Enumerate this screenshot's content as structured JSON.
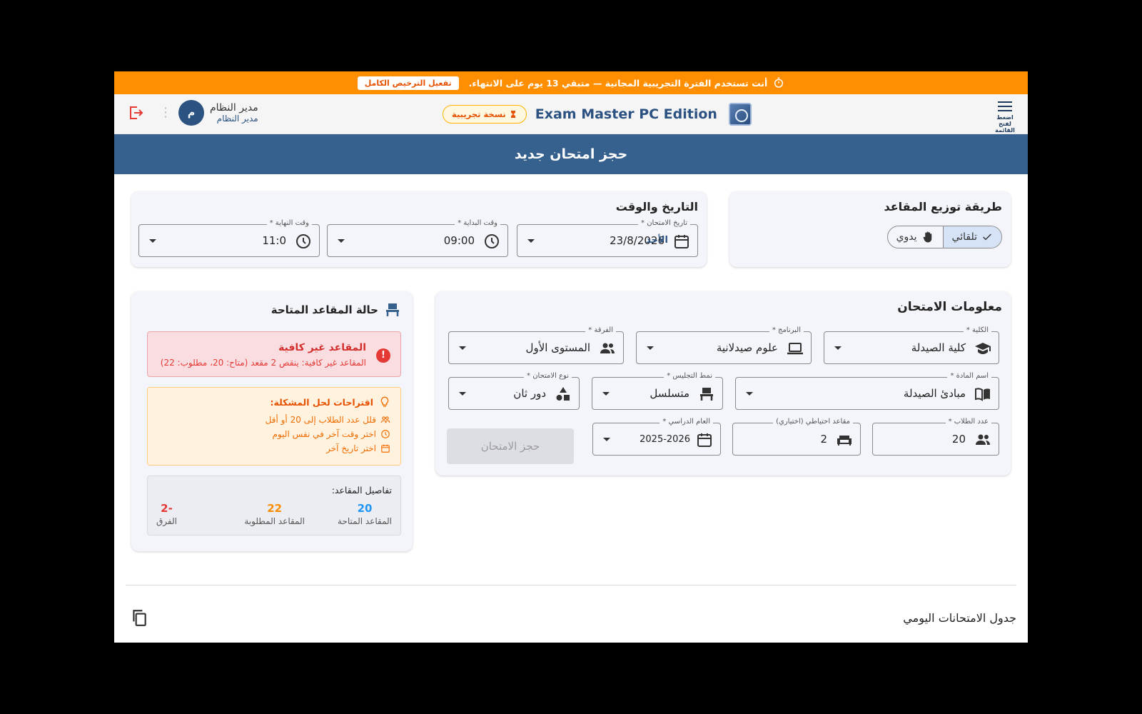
{
  "trial_banner": {
    "message": "أنت تستخدم الفترة التجريبية المجانية — متبقي 13 يوم على الانتهاء.",
    "activate_button": "تفعيل الترخيص الكامل"
  },
  "appbar": {
    "menu_hint": "اضغط لفتح القائمة",
    "app_title": "Exam Master PC Edition",
    "trial_badge": "نسخة تجريبية",
    "user_name": "مدير النظام",
    "user_role": "مدير النظام",
    "avatar_letter": "م"
  },
  "page_title": "حجز امتحان جديد",
  "seat_method": {
    "title": "طريقة توزيع المقاعد",
    "options": [
      "تلقائي",
      "يدوي"
    ],
    "selected": "تلقائي"
  },
  "datetime": {
    "title": "التاريخ والوقت",
    "exam_date_label": "تاريخ الامتحان *",
    "exam_date": "23/8/2026",
    "day_name": "الأحد",
    "start_label": "وقت البداية *",
    "start_time": "09:00",
    "end_label": "وقت النهاية *",
    "end_time": "11:0"
  },
  "exam_info": {
    "title": "معلومات الامتحان",
    "college_label": "الكلية *",
    "college": "كلية الصيدلة",
    "program_label": "البرنامج *",
    "program": "علوم صيدلانية",
    "group_label": "الفرقة *",
    "group": "المستوى الأول",
    "subject_label": "اسم المادة *",
    "subject": "مبادئ الصيدلة",
    "seating_label": "نمط التجليس *",
    "seating": "متسلسل",
    "exam_type_label": "نوع الامتحان *",
    "exam_type": "دور ثان",
    "students_label": "عدد الطلاب *",
    "students": "20",
    "reserve_label": "مقاعد احتياطي (اختياري)",
    "reserve": "2",
    "year_label": "العام الدراسي *",
    "year": "2025-2026",
    "book_button": "حجز الامتحان"
  },
  "seat_status": {
    "title": "حالة المقاعد المتاحة",
    "error_title": "المقاعد غير كافية",
    "error_detail": "المقاعد غير كافية: ينقص 2 مقعد (متاح: 20، مطلوب: 22)",
    "suggest_title": "اقتراحات لحل المشكلة:",
    "suggestions": [
      "قلل عدد الطلاب إلى 20 أو أقل",
      "اختر وقت آخر في نفس اليوم",
      "اختر تاريخ آخر"
    ],
    "details_title": "تفاصيل المقاعد:",
    "available_label": "المقاعد المتاحة",
    "available": "20",
    "required_label": "المقاعد المطلوبة",
    "required": "22",
    "diff_label": "الفرق",
    "diff": "-2"
  },
  "daily_schedule": {
    "title": "جدول الامتحانات اليومي"
  },
  "colors": {
    "primary": "#36618F",
    "banner": "#FF8F00",
    "error": "#E53935",
    "warning": "#EF6C00",
    "available": "#2196F3",
    "required": "#FB8C00"
  }
}
